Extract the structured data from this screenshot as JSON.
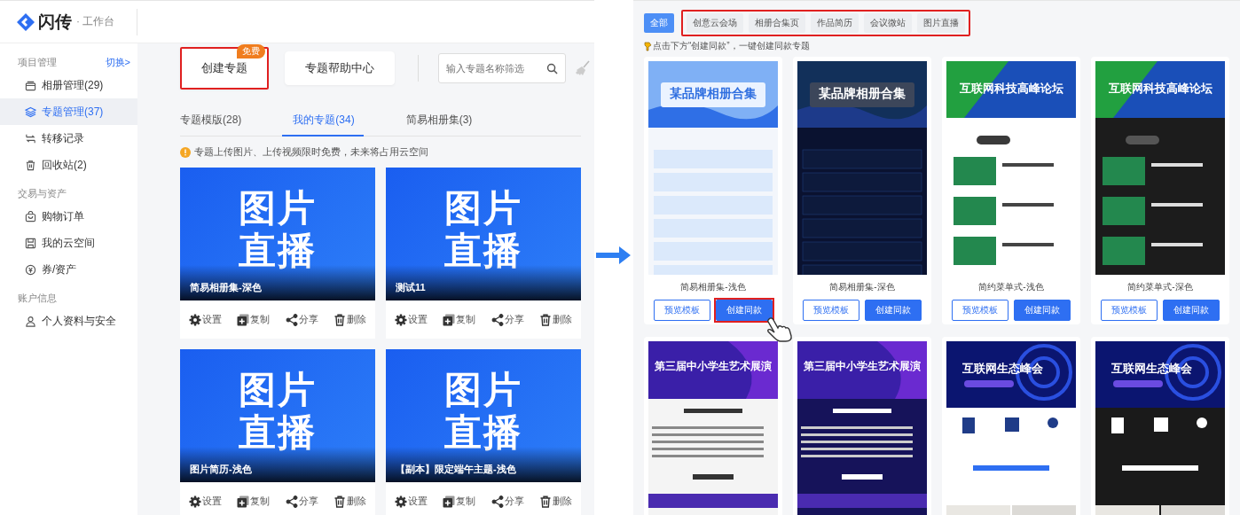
{
  "left": {
    "logo": {
      "name": "闪传",
      "suffix": "· 工作台"
    },
    "sidebar": [
      {
        "title": "项目管理",
        "action": "切换>",
        "items": [
          {
            "label": "相册管理(29)",
            "selected": false
          },
          {
            "label": "专题管理(37)",
            "selected": true
          },
          {
            "label": "转移记录",
            "selected": false
          },
          {
            "label": "回收站(2)",
            "selected": false
          }
        ]
      },
      {
        "title": "交易与资产",
        "items": [
          {
            "label": "购物订单",
            "selected": false
          },
          {
            "label": "我的云空间",
            "selected": false
          },
          {
            "label": "券/资产",
            "selected": false
          }
        ]
      },
      {
        "title": "账户信息",
        "items": [
          {
            "label": "个人资料与安全",
            "selected": false
          }
        ]
      }
    ],
    "toolbar": {
      "buttons": [
        {
          "label": "创建专题",
          "badge": "免费",
          "highlighted": true
        },
        {
          "label": "专题帮助中心",
          "highlighted": false
        }
      ],
      "search": {
        "placeholder": "输入专题名称筛选"
      }
    },
    "tabs": [
      {
        "label": "专题模版(28)",
        "selected": false
      },
      {
        "label": "我的专题(34)",
        "selected": true
      },
      {
        "label": "简易相册集(3)",
        "selected": false
      }
    ],
    "notice": "专题上传图片、上传视频限时免费，未来将占用云空间",
    "cards": [
      {
        "cover": [
          "图片",
          "直播"
        ],
        "name": "简易相册集-深色",
        "actions": [
          "设置",
          "复制",
          "分享",
          "删除"
        ]
      },
      {
        "cover": [
          "图片",
          "直播"
        ],
        "name": "测试11",
        "actions": [
          "设置",
          "复制",
          "分享",
          "删除"
        ]
      },
      {
        "cover": [
          "图片",
          "直播"
        ],
        "name": "图片简历-浅色",
        "actions": [
          "设置",
          "复制",
          "分享",
          "删除"
        ]
      },
      {
        "cover": [
          "图片",
          "直播"
        ],
        "name": "【副本】限定端午主题-浅色",
        "actions": [
          "设置",
          "复制",
          "分享",
          "删除"
        ]
      }
    ]
  },
  "right": {
    "filters": {
      "all": {
        "label": "全部",
        "selected": true
      },
      "group": {
        "highlighted": true,
        "items": [
          {
            "label": "创意云会场",
            "selected": false
          },
          {
            "label": "相册合集页",
            "selected": false
          },
          {
            "label": "作品简历",
            "selected": false
          },
          {
            "label": "会议微站",
            "selected": false
          },
          {
            "label": "图片直播",
            "selected": false
          }
        ]
      }
    },
    "hint": "点击下方“创建同款”，一键创建同款专题",
    "templates": [
      {
        "name": "简易相册集-浅色",
        "buttons": [
          {
            "label": "预览模板",
            "kind": "outline",
            "highlighted": false
          },
          {
            "label": "创建同款",
            "kind": "primary",
            "highlighted": true
          }
        ],
        "preview": {
          "kind": "album",
          "dark": false,
          "title": "某品牌相册合集"
        }
      },
      {
        "name": "简易相册集-深色",
        "buttons": [
          {
            "label": "预览模板",
            "kind": "outline",
            "highlighted": false
          },
          {
            "label": "创建同款",
            "kind": "primary",
            "highlighted": false
          }
        ],
        "preview": {
          "kind": "album",
          "dark": true,
          "title": "某品牌相册合集"
        }
      },
      {
        "name": "简约菜单式-浅色",
        "buttons": [
          {
            "label": "预览模板",
            "kind": "outline",
            "highlighted": false
          },
          {
            "label": "创建同款",
            "kind": "primary",
            "highlighted": false
          }
        ],
        "preview": {
          "kind": "menu",
          "dark": false,
          "title": "互联网科技高峰论坛"
        }
      },
      {
        "name": "简约菜单式-深色",
        "buttons": [
          {
            "label": "预览模板",
            "kind": "outline",
            "highlighted": false
          },
          {
            "label": "创建同款",
            "kind": "primary",
            "highlighted": false
          }
        ],
        "preview": {
          "kind": "menu",
          "dark": true,
          "title": "互联网科技高峰论坛"
        }
      },
      {
        "preview": {
          "kind": "event",
          "dark": false,
          "title": "第三届中小学生艺术展演"
        }
      },
      {
        "preview": {
          "kind": "event",
          "dark": true,
          "title": "第三届中小学生艺术展演"
        }
      },
      {
        "preview": {
          "kind": "summit",
          "dark": false,
          "title": "互联网生态峰会"
        }
      },
      {
        "preview": {
          "kind": "summit",
          "dark": true,
          "title": "互联网生态峰会"
        }
      }
    ]
  }
}
